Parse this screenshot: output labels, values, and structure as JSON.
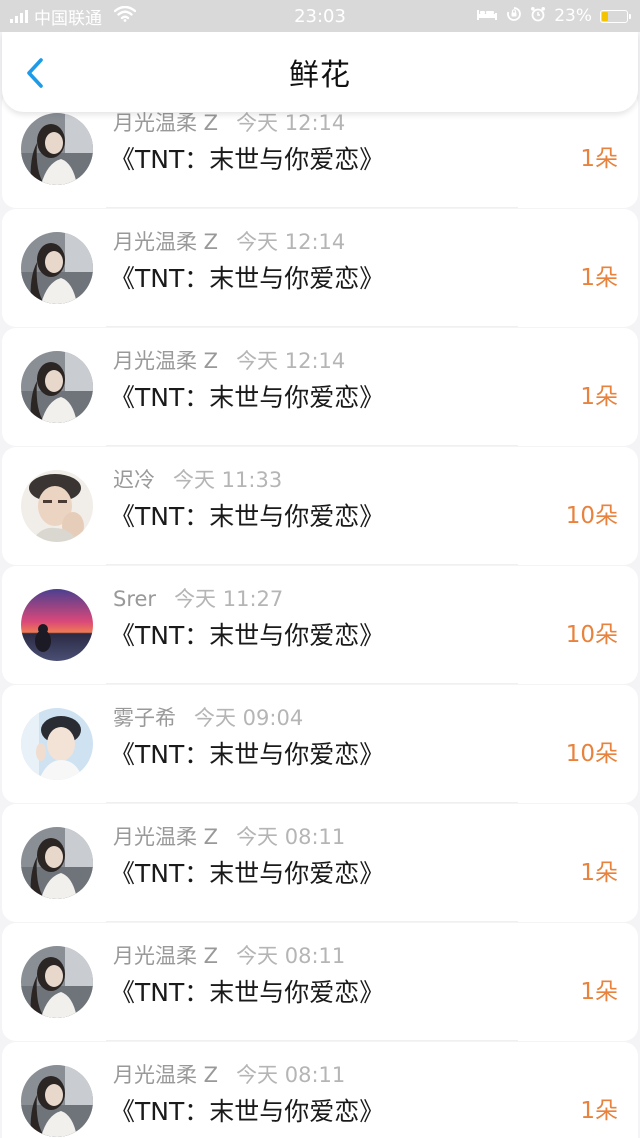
{
  "status_bar": {
    "carrier": "中国联通",
    "time": "23:03",
    "battery_percent": "23%",
    "battery_level": 0.23,
    "icons": [
      "signal-icon",
      "wifi-icon",
      "bed-icon",
      "orientation-lock-icon",
      "alarm-icon",
      "battery-icon"
    ]
  },
  "nav": {
    "title": "鲜花",
    "back_icon": "chevron-left-icon",
    "accent": "#1e9be8"
  },
  "colors": {
    "count": "#e8823c",
    "meta": "#999999"
  },
  "items": [
    {
      "username": "月光温柔 Z",
      "time": "今天 12:14",
      "title": "《TNT：末世与你爱恋》",
      "count": "1朵",
      "avatar": "girl-gray"
    },
    {
      "username": "月光温柔 Z",
      "time": "今天 12:14",
      "title": "《TNT：末世与你爱恋》",
      "count": "1朵",
      "avatar": "girl-gray"
    },
    {
      "username": "月光温柔 Z",
      "time": "今天 12:14",
      "title": "《TNT：末世与你爱恋》",
      "count": "1朵",
      "avatar": "girl-gray"
    },
    {
      "username": "迟冷",
      "time": "今天 11:33",
      "title": "《TNT：末世与你爱恋》",
      "count": "10朵",
      "avatar": "boy-cap"
    },
    {
      "username": "Srer",
      "time": "今天 11:27",
      "title": "《TNT：末世与你爱恋》",
      "count": "10朵",
      "avatar": "sunset"
    },
    {
      "username": "雾子希",
      "time": "今天 09:04",
      "title": "《TNT：末世与你爱恋》",
      "count": "10朵",
      "avatar": "boy-blue"
    },
    {
      "username": "月光温柔 Z",
      "time": "今天 08:11",
      "title": "《TNT：末世与你爱恋》",
      "count": "1朵",
      "avatar": "girl-gray"
    },
    {
      "username": "月光温柔 Z",
      "time": "今天 08:11",
      "title": "《TNT：末世与你爱恋》",
      "count": "1朵",
      "avatar": "girl-gray"
    },
    {
      "username": "月光温柔 Z",
      "time": "今天 08:11",
      "title": "《TNT：末世与你爱恋》",
      "count": "1朵",
      "avatar": "girl-gray"
    }
  ]
}
